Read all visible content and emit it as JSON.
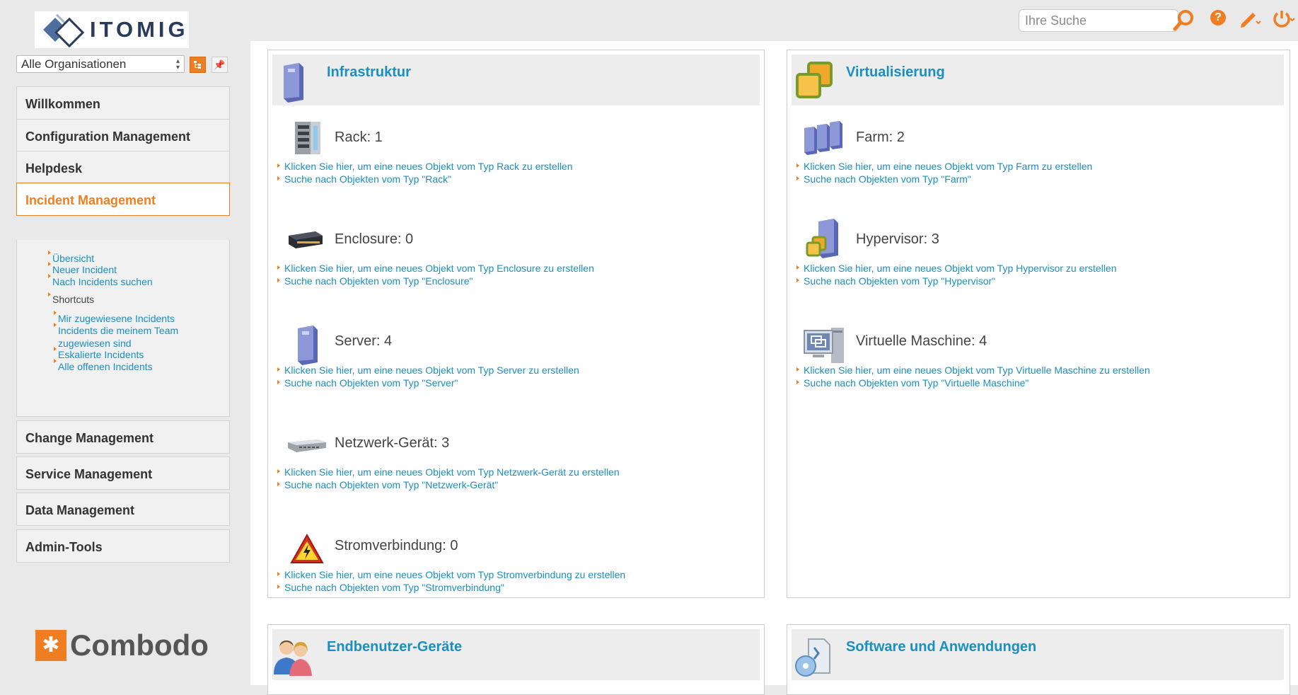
{
  "header": {
    "logo_text": "ITOMIG",
    "search_placeholder": "Ihre Suche",
    "icons": [
      "search-icon",
      "help-icon",
      "edit-icon",
      "power-icon"
    ]
  },
  "sidebar": {
    "org_select": "Alle Organisationen",
    "menu": [
      {
        "label": "Willkommen"
      },
      {
        "label": "Configuration Management"
      },
      {
        "label": "Helpdesk"
      },
      {
        "label": "Incident Management",
        "active": true
      },
      {
        "label": "Change Management"
      },
      {
        "label": "Service Management"
      },
      {
        "label": "Data Management"
      },
      {
        "label": "Admin-Tools"
      }
    ],
    "incident_sub": {
      "links": [
        "Übersicht",
        "Neuer Incident",
        "Nach Incidents suchen"
      ],
      "shortcuts_label": "Shortcuts",
      "shortcuts": [
        "Mir zugewiesene Incidents",
        "Incidents die meinem Team zugewiesen sind",
        "Eskalierte Incidents",
        "Alle offenen Incidents"
      ]
    },
    "vendor_logo": "Combodo"
  },
  "dashlets": [
    {
      "title": "Infrastruktur",
      "entries": [
        {
          "count_label": "Rack: 1",
          "create": "Klicken Sie hier, um eine neues Objekt vom Typ Rack zu erstellen",
          "search": "Suche nach Objekten vom Typ \"Rack\""
        },
        {
          "count_label": "Enclosure: 0",
          "create": "Klicken Sie hier, um eine neues Objekt vom Typ Enclosure zu erstellen",
          "search": "Suche nach Objekten vom Typ \"Enclosure\""
        },
        {
          "count_label": "Server: 4",
          "create": "Klicken Sie hier, um eine neues Objekt vom Typ Server zu erstellen",
          "search": "Suche nach Objekten vom Typ \"Server\""
        },
        {
          "count_label": "Netzwerk-Gerät: 3",
          "create": "Klicken Sie hier, um eine neues Objekt vom Typ Netzwerk-Gerät zu erstellen",
          "search": "Suche nach Objekten vom Typ \"Netzwerk-Gerät\""
        },
        {
          "count_label": "Stromverbindung: 0",
          "create": "Klicken Sie hier, um eine neues Objekt vom Typ Stromverbindung zu erstellen",
          "search": "Suche nach Objekten vom Typ \"Stromverbindung\""
        }
      ]
    },
    {
      "title": "Virtualisierung",
      "entries": [
        {
          "count_label": "Farm: 2",
          "create": "Klicken Sie hier, um eine neues Objekt vom Typ Farm zu erstellen",
          "search": "Suche nach Objekten vom Typ \"Farm\""
        },
        {
          "count_label": "Hypervisor: 3",
          "create": "Klicken Sie hier, um eine neues Objekt vom Typ Hypervisor zu erstellen",
          "search": "Suche nach Objekten vom Typ \"Hypervisor\""
        },
        {
          "count_label": "Virtuelle Maschine: 4",
          "create": "Klicken Sie hier, um eine neues Objekt vom Typ Virtuelle Maschine zu erstellen",
          "search": "Suche nach Objekten vom Typ \"Virtuelle Maschine\""
        }
      ]
    },
    {
      "title": "Endbenutzer-Geräte"
    },
    {
      "title": "Software und Anwendungen"
    }
  ]
}
